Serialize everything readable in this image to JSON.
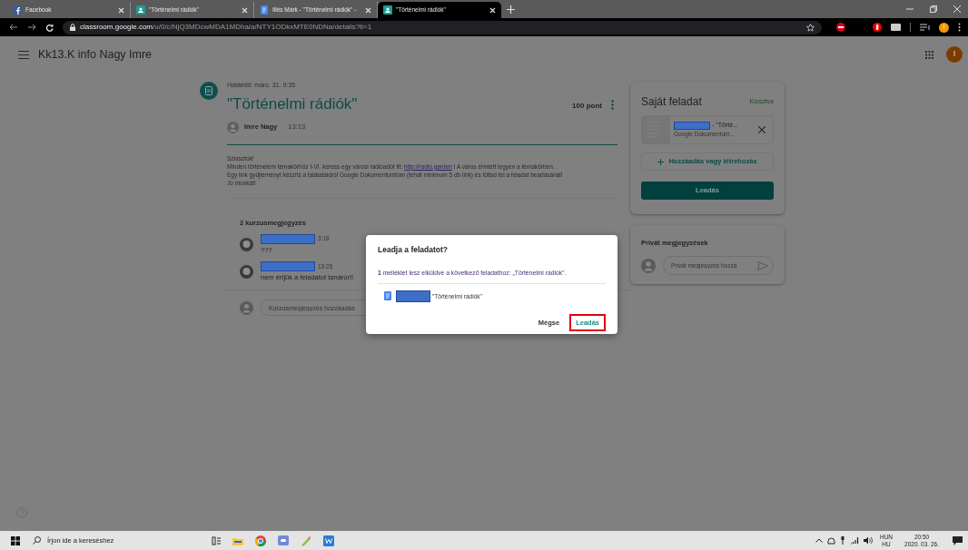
{
  "browser": {
    "tabs": [
      {
        "title": "Facebook",
        "kind": "facebook",
        "selected": false
      },
      {
        "title": "\"Történelmi rádiók\"",
        "kind": "classroom",
        "selected": false
      },
      {
        "title": "Illés Márk - \"Történelmi rádiók\" -",
        "kind": "docs",
        "selected": false
      },
      {
        "title": "\"Történelmi rádiók\"",
        "kind": "classroom",
        "selected": true
      }
    ],
    "url": {
      "host": "classroom.google.com",
      "path": "/u/0/c/NjQ3MDcwMDA1MDha/a/NTY1ODkxMTE0NDNa/details?ti=1"
    },
    "avatar_letter": "I"
  },
  "app_header": {
    "title": "Kk13.K info Nagy Imre",
    "avatar_letter": "I"
  },
  "assignment": {
    "due": "Határidő: márc. 31. 9:35",
    "title": "\"Történelmi rádiók\"",
    "points": "100 pont",
    "author": "Imre Nagy",
    "time": "13:13",
    "body": [
      {
        "text": "Sziasztok!"
      },
      {
        "text": "Minden történelem témakörhöz I-VI. keress egy városi rádióadót itt:",
        "link": "http://radio.garden",
        "after": "! A város érintett legyen a témakörben."
      },
      {
        "text": "Egy link gyűjteményt készíts a találataidról Google Dokumentumban (tehát minimum 5 db link) és töltsd fel a feladat beadásánál!"
      },
      {
        "text": "Jó munkát!"
      }
    ]
  },
  "comments": {
    "heading": "2 kurzusmegjegyzés",
    "items": [
      {
        "time": "3:18",
        "text": "???"
      },
      {
        "time": "13:25",
        "text": "nem értjük a feladatot tanárúr!!"
      }
    ],
    "placeholder": "Kurzusmegjegyzés hozzáadás"
  },
  "my_work": {
    "title": "Saját feladat",
    "status": "Kiosztva",
    "attachment": {
      "title": "- \"Törté...",
      "subtitle": "Google Dokumentum..."
    },
    "add_button": "Hozzáadás vagy létrehozás",
    "submit_button": "Leadás"
  },
  "private_notes": {
    "title": "Privát megjegyzések",
    "placeholder": "Privát megjegyzés hozzá"
  },
  "dialog": {
    "title": "Leadja a feladatot?",
    "message": "**1** melléklet lesz elküldve a következő feladathoz: „Történelmi rádiók”.",
    "attachment": "\"Történelmi rádiók\"",
    "buttons": [
      {
        "label": "Mégse",
        "kind": "cancel",
        "highlighted": false
      },
      {
        "label": "Leadás",
        "kind": "submit",
        "highlighted": true
      }
    ]
  },
  "taskbar": {
    "search_placeholder": "Írjon ide a kereséshez",
    "lang_top": "HUN",
    "lang_bottom": "HU",
    "time": "20:50",
    "date": "2020. 03. 26."
  }
}
